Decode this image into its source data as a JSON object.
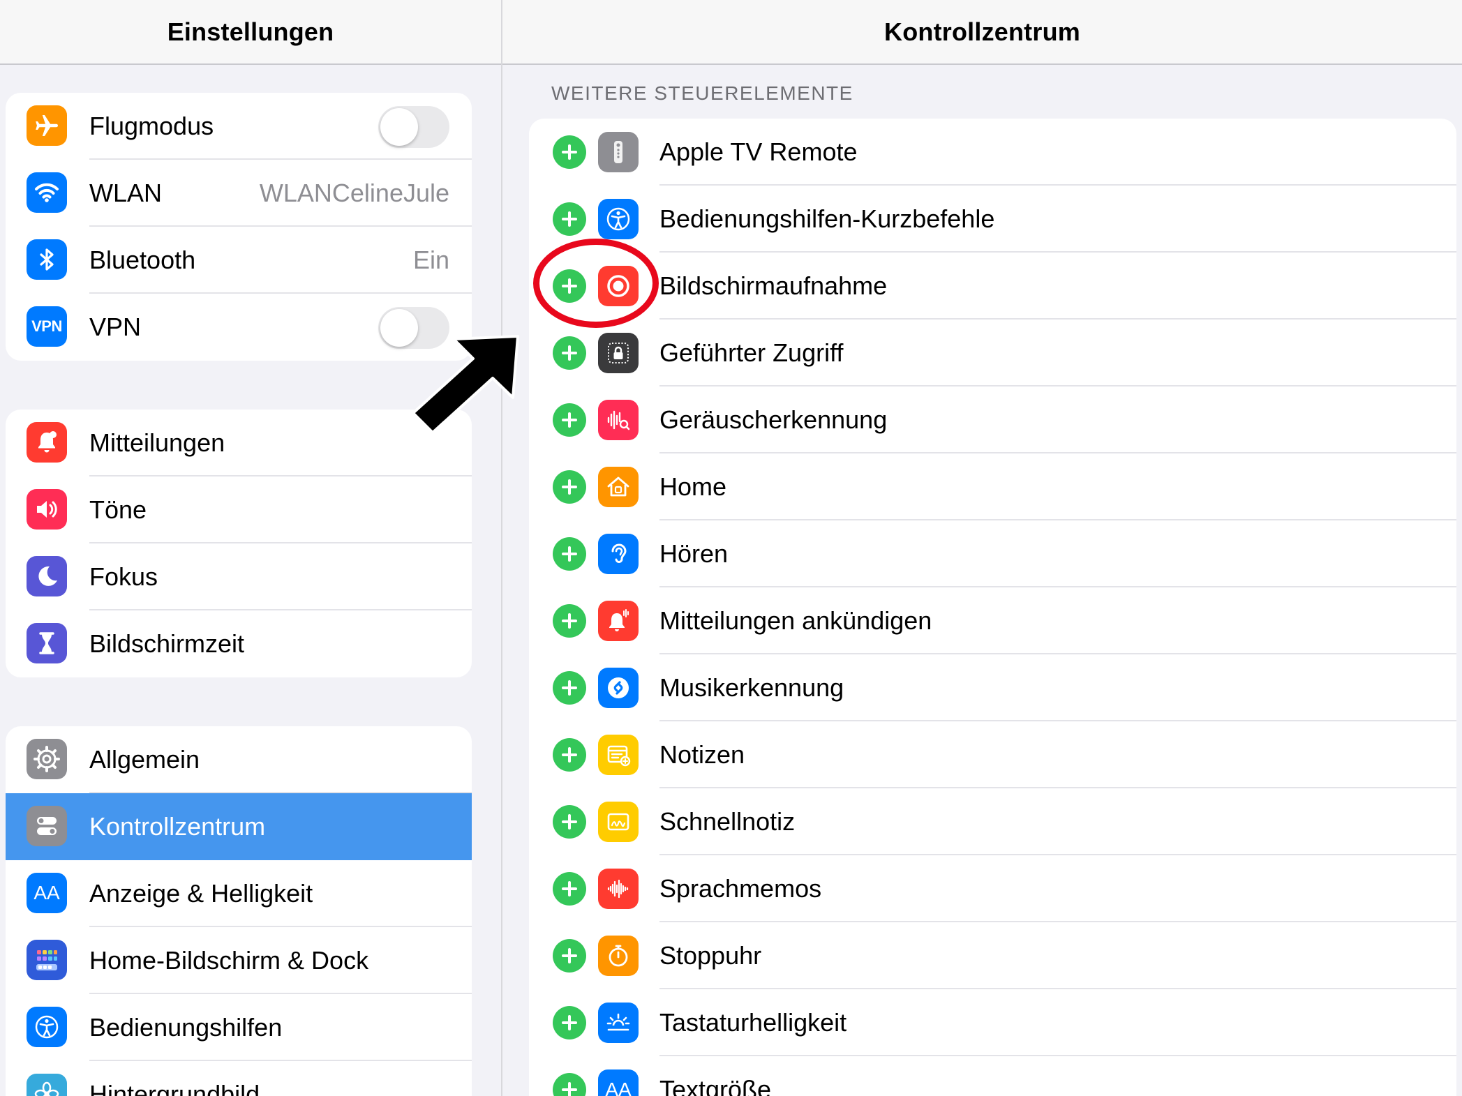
{
  "sidebar": {
    "title": "Einstellungen",
    "groups": [
      {
        "items": [
          {
            "label": "Flugmodus",
            "icon": "airplane-icon",
            "color": "#ff9500",
            "toggle": false
          },
          {
            "label": "WLAN",
            "icon": "wifi-icon",
            "color": "#007aff",
            "value": "WLANCelineJule"
          },
          {
            "label": "Bluetooth",
            "icon": "bluetooth-icon",
            "color": "#007aff",
            "value": "Ein"
          },
          {
            "label": "VPN",
            "icon": "vpn-icon",
            "icon_text": "VPN",
            "color": "#007aff",
            "toggle": false
          }
        ]
      },
      {
        "items": [
          {
            "label": "Mitteilungen",
            "icon": "notification-bell-icon",
            "color": "#ff3b30"
          },
          {
            "label": "Töne",
            "icon": "speaker-icon",
            "color": "#ff2d55"
          },
          {
            "label": "Fokus",
            "icon": "moon-icon",
            "color": "#5856d6"
          },
          {
            "label": "Bildschirmzeit",
            "icon": "hourglass-icon",
            "color": "#5856d6"
          }
        ]
      },
      {
        "items": [
          {
            "label": "Allgemein",
            "icon": "gear-icon",
            "color": "#8e8e93"
          },
          {
            "label": "Kontrollzentrum",
            "icon": "switches-icon",
            "color": "#8e8e93",
            "selected": true
          },
          {
            "label": "Anzeige & Helligkeit",
            "icon": "text-size-icon",
            "icon_text": "AA",
            "color": "#007aff"
          },
          {
            "label": "Home-Bildschirm & Dock",
            "icon": "home-grid-icon",
            "color": "#2f5bd9"
          },
          {
            "label": "Bedienungshilfen",
            "icon": "accessibility-icon",
            "color": "#007aff"
          },
          {
            "label": "Hintergrundbild",
            "icon": "flower-icon",
            "color": "#36aadc"
          }
        ]
      }
    ]
  },
  "main": {
    "title": "Kontrollzentrum",
    "section_header": "WEITERE STEUERELEMENTE",
    "items": [
      {
        "label": "Apple TV Remote",
        "icon": "remote-icon",
        "color": "#8e8e93"
      },
      {
        "label": "Bedienungshilfen-Kurzbefehle",
        "icon": "accessibility-icon",
        "color": "#007aff"
      },
      {
        "label": "Bildschirmaufnahme",
        "icon": "record-icon",
        "color": "#ff3b30"
      },
      {
        "label": "Geführter Zugriff",
        "icon": "lock-icon",
        "color": "#3a3a3c"
      },
      {
        "label": "Geräuscherkennung",
        "icon": "sound-recognition-icon",
        "color": "#ff2d55"
      },
      {
        "label": "Home",
        "icon": "house-icon",
        "color": "#ff9500"
      },
      {
        "label": "Hören",
        "icon": "ear-icon",
        "color": "#007aff"
      },
      {
        "label": "Mitteilungen ankündigen",
        "icon": "announce-bell-icon",
        "color": "#ff3b30"
      },
      {
        "label": "Musikerkennung",
        "icon": "shazam-icon",
        "color": "#007aff"
      },
      {
        "label": "Notizen",
        "icon": "notes-icon",
        "color": "#ffcc00"
      },
      {
        "label": "Schnellnotiz",
        "icon": "quick-note-icon",
        "color": "#ffcc00"
      },
      {
        "label": "Sprachmemos",
        "icon": "waveform-icon",
        "color": "#ff3b30"
      },
      {
        "label": "Stoppuhr",
        "icon": "stopwatch-icon",
        "color": "#ff9500"
      },
      {
        "label": "Tastaturhelligkeit",
        "icon": "keyboard-brightness-icon",
        "color": "#007aff"
      },
      {
        "label": "Textgröße",
        "icon": "text-size-icon",
        "icon_text": "AA",
        "color": "#007aff"
      }
    ]
  },
  "colors": {
    "add_button": "#34c759",
    "selection": "#4596ee",
    "annotation": "#e8081c"
  }
}
